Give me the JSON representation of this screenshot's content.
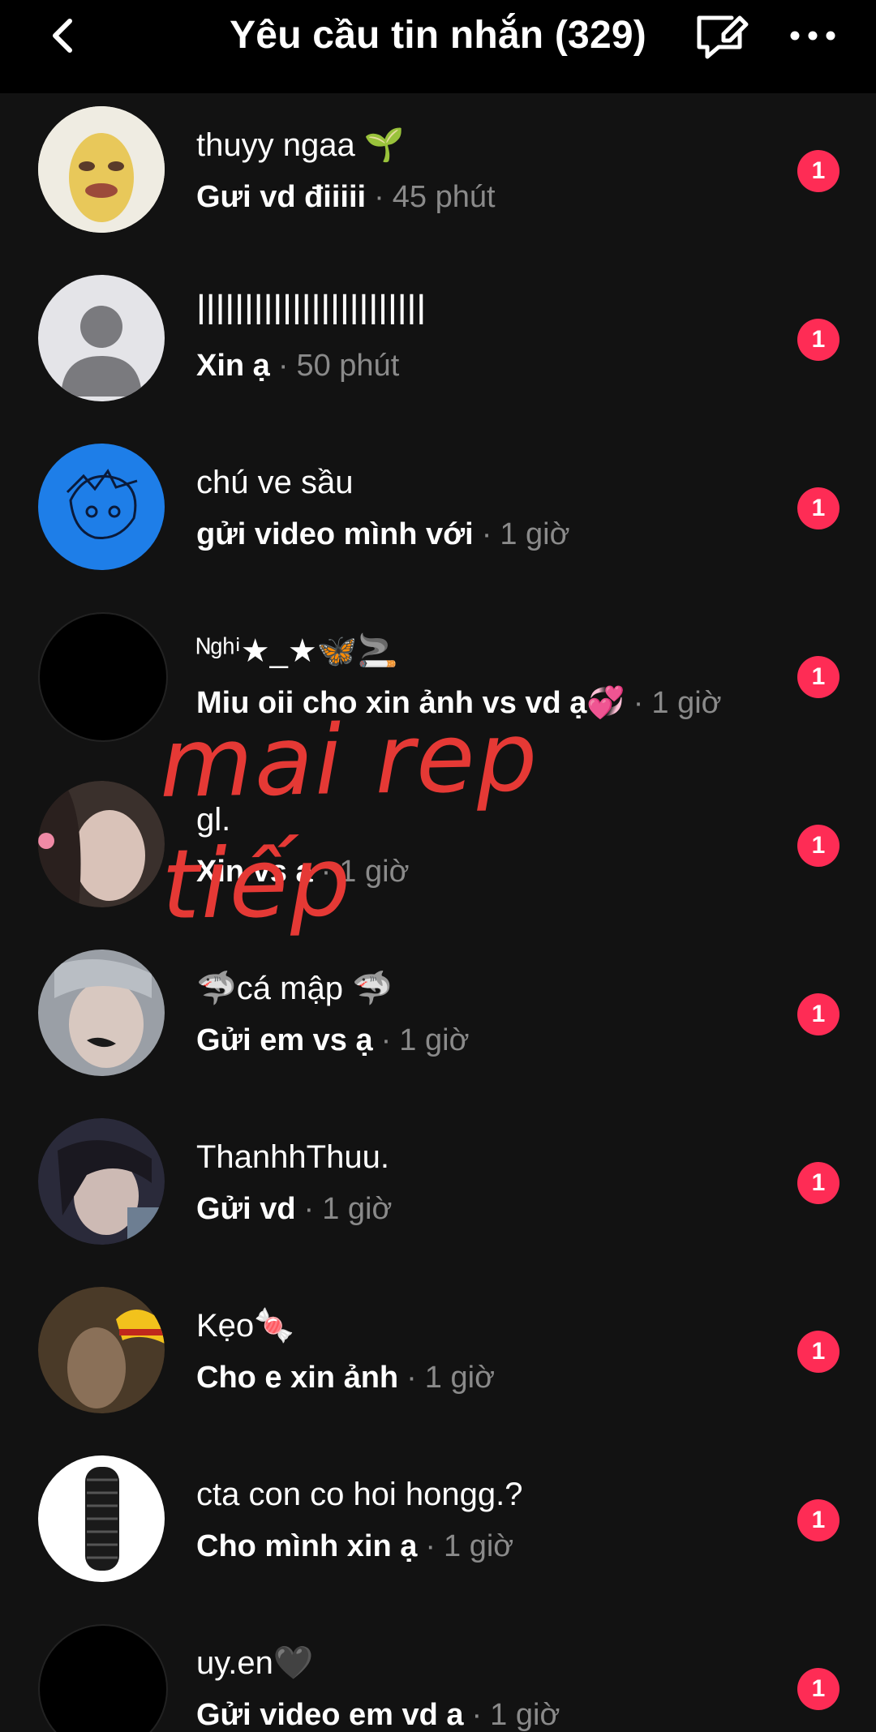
{
  "header": {
    "title": "Yêu cầu tin nhắn (329)",
    "back_icon": "chevron-left-icon",
    "compose_icon": "chat-bubble-edit-icon",
    "more_icon": "more-horizontal-icon"
  },
  "requests": [
    {
      "name": "thuyy ngaa 🌱",
      "message": "Gưi vd điiiii",
      "time": "45 phút",
      "badge": "1"
    },
    {
      "name": "ꟾꟾꟾꟾꟾꟾꟾꟾꟾꟾꟾꟾꟾꟾꟾꟾꟾꟾꟾꟾꟾꟾꟾꟾ",
      "message": "Xin ạ",
      "time": "50 phút",
      "badge": "1"
    },
    {
      "name": "chú ve sầu",
      "message": "gửi video mình với",
      "time": "1 giờ",
      "badge": "1"
    },
    {
      "name": "ᴺᵍʰⁱ★_★🦋🚬",
      "message": "Miu oii cho xin ảnh vs vd ạ💞",
      "time": "1 giờ",
      "badge": "1"
    },
    {
      "name": "gl.",
      "message": "Xin vs ạ",
      "time": "1 giờ",
      "badge": "1"
    },
    {
      "name": "🦈cá mập 🦈",
      "message": "Gửi em vs ạ",
      "time": "1 giờ",
      "badge": "1"
    },
    {
      "name": "ThanhhThuu.",
      "message": "Gửi vd",
      "time": "1 giờ",
      "badge": "1"
    },
    {
      "name": "Kẹo🍬",
      "message": "Cho e xin ảnh",
      "time": "1 giờ",
      "badge": "1"
    },
    {
      "name": "cta con co hoi hongg.?",
      "message": "Cho mình xin ạ",
      "time": "1 giờ",
      "badge": "1"
    },
    {
      "name": "uy.en🖤",
      "message": "Gửi video em vd a",
      "time": "1 giờ",
      "badge": "1"
    }
  ],
  "overlay": {
    "text": "mai rep tiếp",
    "color": "#e53935"
  },
  "colors": {
    "background": "#121212",
    "header": "#000000",
    "badge": "#fe2c55",
    "muted": "#8a8a8a"
  }
}
